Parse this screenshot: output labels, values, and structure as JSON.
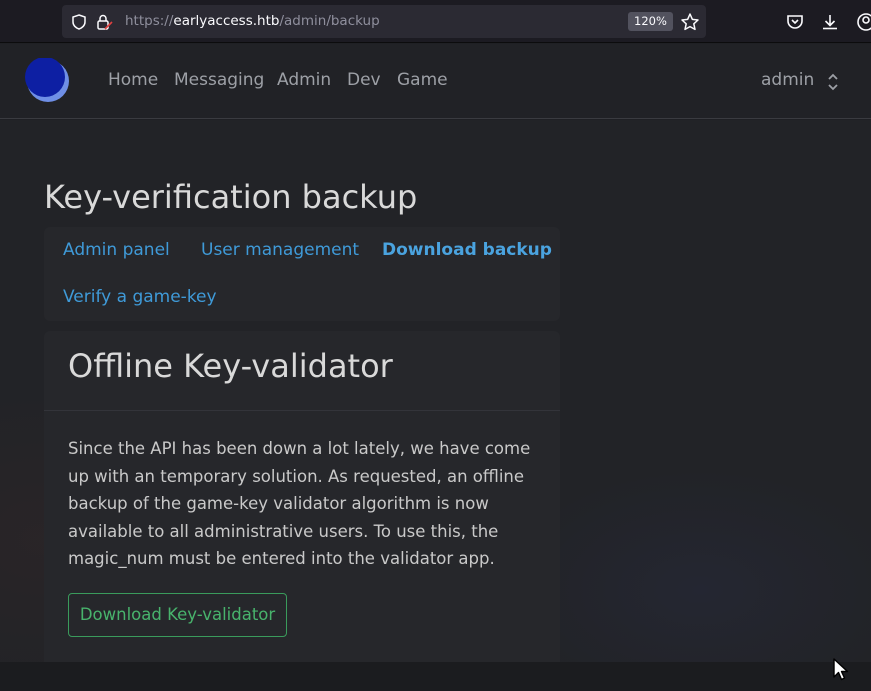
{
  "browser": {
    "url_prefix": "https://",
    "url_host": "earlyaccess.htb",
    "url_path": "/admin/backup",
    "zoom": "120%"
  },
  "nav": {
    "links": [
      "Home",
      "Messaging",
      "Admin",
      "Dev",
      "Game"
    ],
    "user": "admin"
  },
  "page": {
    "title": "Key-verification backup",
    "tabs": [
      "Admin panel",
      "User management",
      "Download backup",
      "Verify a game-key"
    ],
    "active_tab": "Download backup"
  },
  "card": {
    "title": "Offline Key-validator",
    "text": "Since the API has been down a lot lately, we have come up with an temporary solution. As requested, an offline backup of the game-key validator algorithm is now available to all administrative users. To use this, the magic_num must be entered into the validator app.",
    "button_label": "Download Key-validator"
  },
  "colors": {
    "link": "#3f9ad8",
    "success": "#48b36c"
  }
}
